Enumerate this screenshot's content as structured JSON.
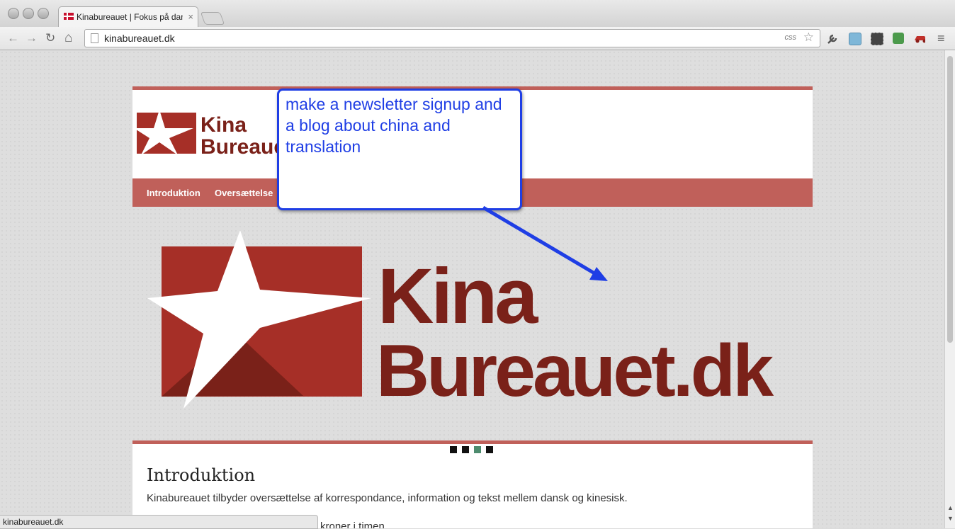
{
  "browser": {
    "tab_title": "Kinabureauet | Fokus på dansk",
    "tab_close": "×",
    "url": "kinabureauet.dk",
    "css_badge": "css",
    "star": "☆",
    "back": "←",
    "forward": "→",
    "reload": "↻",
    "home": "⌂",
    "menu": "≡",
    "status_text": "kinabureauet.dk"
  },
  "colors": {
    "brand_red": "#a62f27",
    "brand_dark": "#7a2119",
    "menu_bar": "#c0605a",
    "annotation_blue": "#1f3ee5",
    "active_dot": "#4e8c6e"
  },
  "header": {
    "logo_line1": "Kina",
    "logo_line2": "Bureauet"
  },
  "menu": {
    "items": [
      "Introduktion",
      "Oversættelse"
    ]
  },
  "hero": {
    "logo_line1": "Kina",
    "logo_line2": "Bureauet.dk"
  },
  "content": {
    "heading": "Introduktion",
    "paragraph": "Kinabureauet tilbyder oversættelse af korrespondance, information og tekst mellem dansk og kinesisk.",
    "partial_line": "kroner i timen"
  },
  "annotation": {
    "text": "make a newsletter signup and a blog about china and translation"
  },
  "icons": [
    "wrench-icon",
    "extension-icon",
    "evernote-icon",
    "translate-icon",
    "car-icon",
    "menu-icon"
  ]
}
